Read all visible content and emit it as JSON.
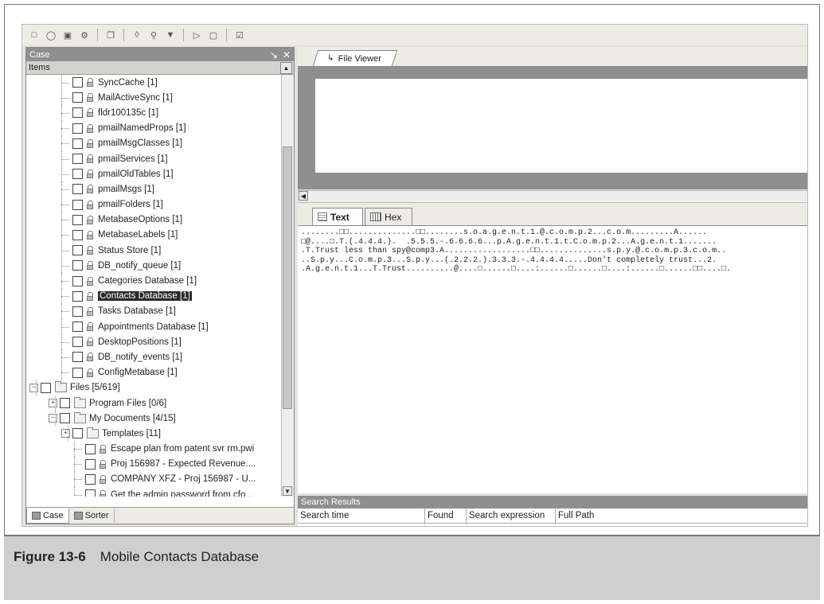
{
  "toolbar": {
    "icons": [
      "new-case-icon",
      "open-icon",
      "save-icon",
      "settings-icon",
      "copy-icon",
      "binoculars-icon",
      "find-icon",
      "filter-icon",
      "go-icon",
      "stop-icon",
      "report-icon"
    ]
  },
  "left_panel": {
    "title": "Case",
    "pin": "↘",
    "close": "✕",
    "items_header": "Items",
    "tree": [
      {
        "label": "SyncCache [1]"
      },
      {
        "label": "MailActiveSync [1]"
      },
      {
        "label": "fldr100135c [1]"
      },
      {
        "label": "pmailNamedProps [1]"
      },
      {
        "label": "pmailMsgClasses [1]"
      },
      {
        "label": "pmailServices [1]"
      },
      {
        "label": "pmailOldTables [1]"
      },
      {
        "label": "pmailMsgs [1]"
      },
      {
        "label": "pmailFolders [1]"
      },
      {
        "label": "MetabaseOptions [1]"
      },
      {
        "label": "MetabaseLabels [1]"
      },
      {
        "label": "Status Store [1]"
      },
      {
        "label": "DB_notify_queue [1]"
      },
      {
        "label": "Categories Database [1]"
      },
      {
        "label": "Contacts Database [1]"
      },
      {
        "label": "Tasks Database [1]"
      },
      {
        "label": "Appointments Database [1]"
      },
      {
        "label": "DesktopPositions [1]"
      },
      {
        "label": "DB_notify_events [1]"
      },
      {
        "label": "ConfigMetabase [1]"
      },
      {
        "label": "Files [5/619]"
      },
      {
        "label": "Program Files [0/6]"
      },
      {
        "label": "My Documents [4/15]"
      },
      {
        "label": "Templates [11]"
      },
      {
        "label": "Escape plan from patent svr rm.pwi"
      },
      {
        "label": "Proj 156987 - Expected Revenue...."
      },
      {
        "label": "COMPANY XFZ - Proj 156987 - U..."
      },
      {
        "label": "Get the admin password from cfo..."
      }
    ],
    "bottom_tabs": [
      {
        "label": "Case"
      },
      {
        "label": "Sorter"
      }
    ]
  },
  "right_panel": {
    "file_viewer_tab": "File Viewer",
    "text_tab": "Text",
    "hex_tab": "Hex",
    "text_lines": [
      "........□□..............□□........s.o.a.g.e.n.t.1.@.c.o.m.p.2...c.o.m.........A......",
      "□@....□.T.(.4.4.4.).  .5.5.5.-.6.6.6.6...p.A.g.e.n.t.1.t.C.o.m.p.2...A.g.e.n.t.1.......",
      ".T.Trust less than spy@comp3.A..................□□..............s.p.y.@.c.o.m.p.3.c.o.m..",
      "..S.p.y...C.o.m.p.3...S.p.y...(.2.2.2.).3.3.3.-.4.4.4.4.....Don't completely trust...2.",
      ".A.g.e.n.t.1...T.Trust..........@....□......□....:......□......□....:......□......□□....□."
    ],
    "search": {
      "title": "Search Results",
      "columns": [
        "Search time",
        "Found",
        "Search expression",
        "Full Path"
      ]
    }
  },
  "caption": {
    "number": "Figure 13-6",
    "text": "Mobile Contacts Database"
  }
}
